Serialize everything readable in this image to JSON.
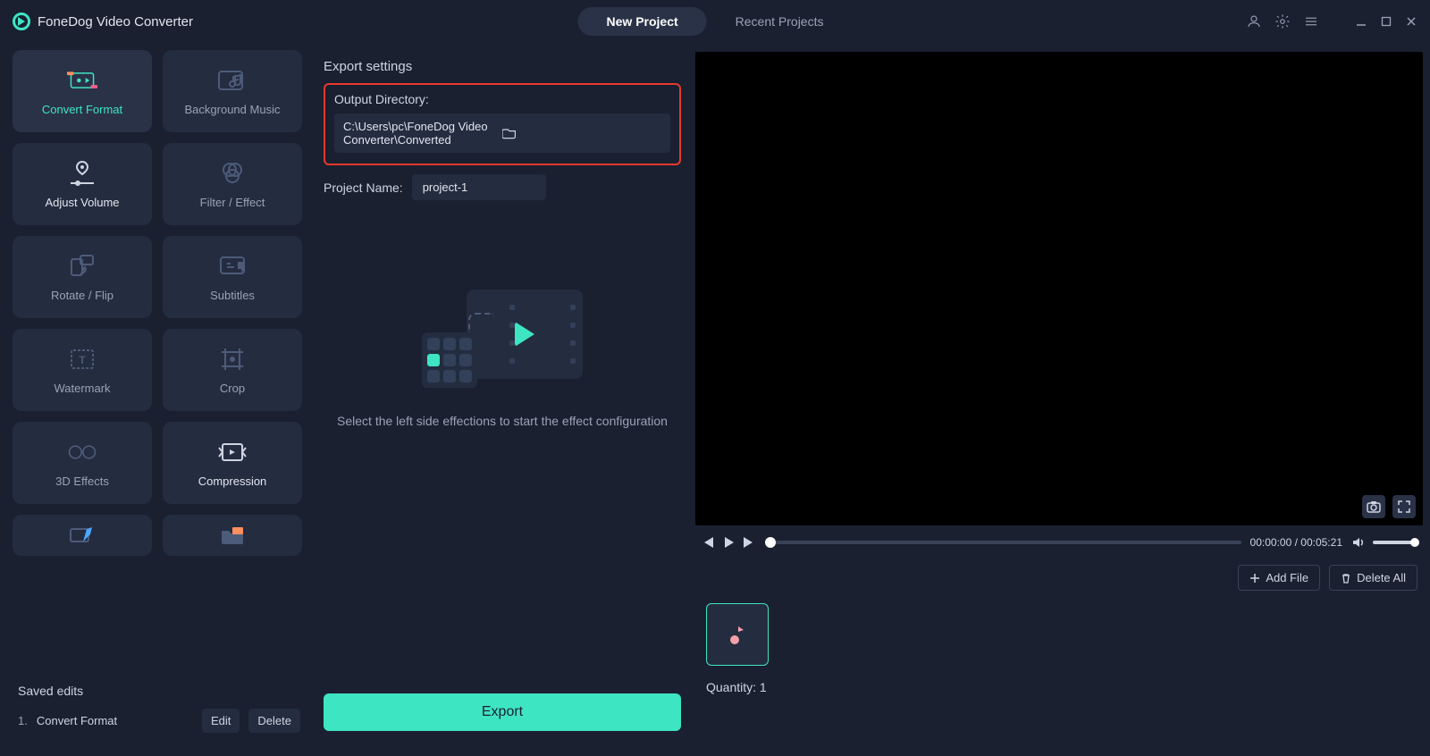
{
  "app_title": "FoneDog Video Converter",
  "tabs": {
    "new_project": "New Project",
    "recent_projects": "Recent Projects"
  },
  "tools": [
    {
      "label": "Convert Format"
    },
    {
      "label": "Background Music"
    },
    {
      "label": "Adjust Volume"
    },
    {
      "label": "Filter / Effect"
    },
    {
      "label": "Rotate / Flip"
    },
    {
      "label": "Subtitles"
    },
    {
      "label": "Watermark"
    },
    {
      "label": "Crop"
    },
    {
      "label": "3D Effects"
    },
    {
      "label": "Compression"
    }
  ],
  "saved": {
    "title": "Saved edits",
    "items": [
      {
        "num": "1.",
        "label": "Convert Format"
      }
    ],
    "edit": "Edit",
    "delete": "Delete"
  },
  "export": {
    "title": "Export settings",
    "outdir_label": "Output Directory:",
    "outdir_value": "C:\\Users\\pc\\FoneDog Video Converter\\Converted",
    "projname_label": "Project Name:",
    "projname_value": "project-1",
    "hint": "Select the left side effections to start the effect configuration",
    "export_btn": "Export"
  },
  "player": {
    "time_current": "00:00:00",
    "time_total": "00:05:21"
  },
  "files": {
    "add": "Add File",
    "delete": "Delete All",
    "quantity_label": "Quantity:",
    "quantity_value": "1"
  }
}
